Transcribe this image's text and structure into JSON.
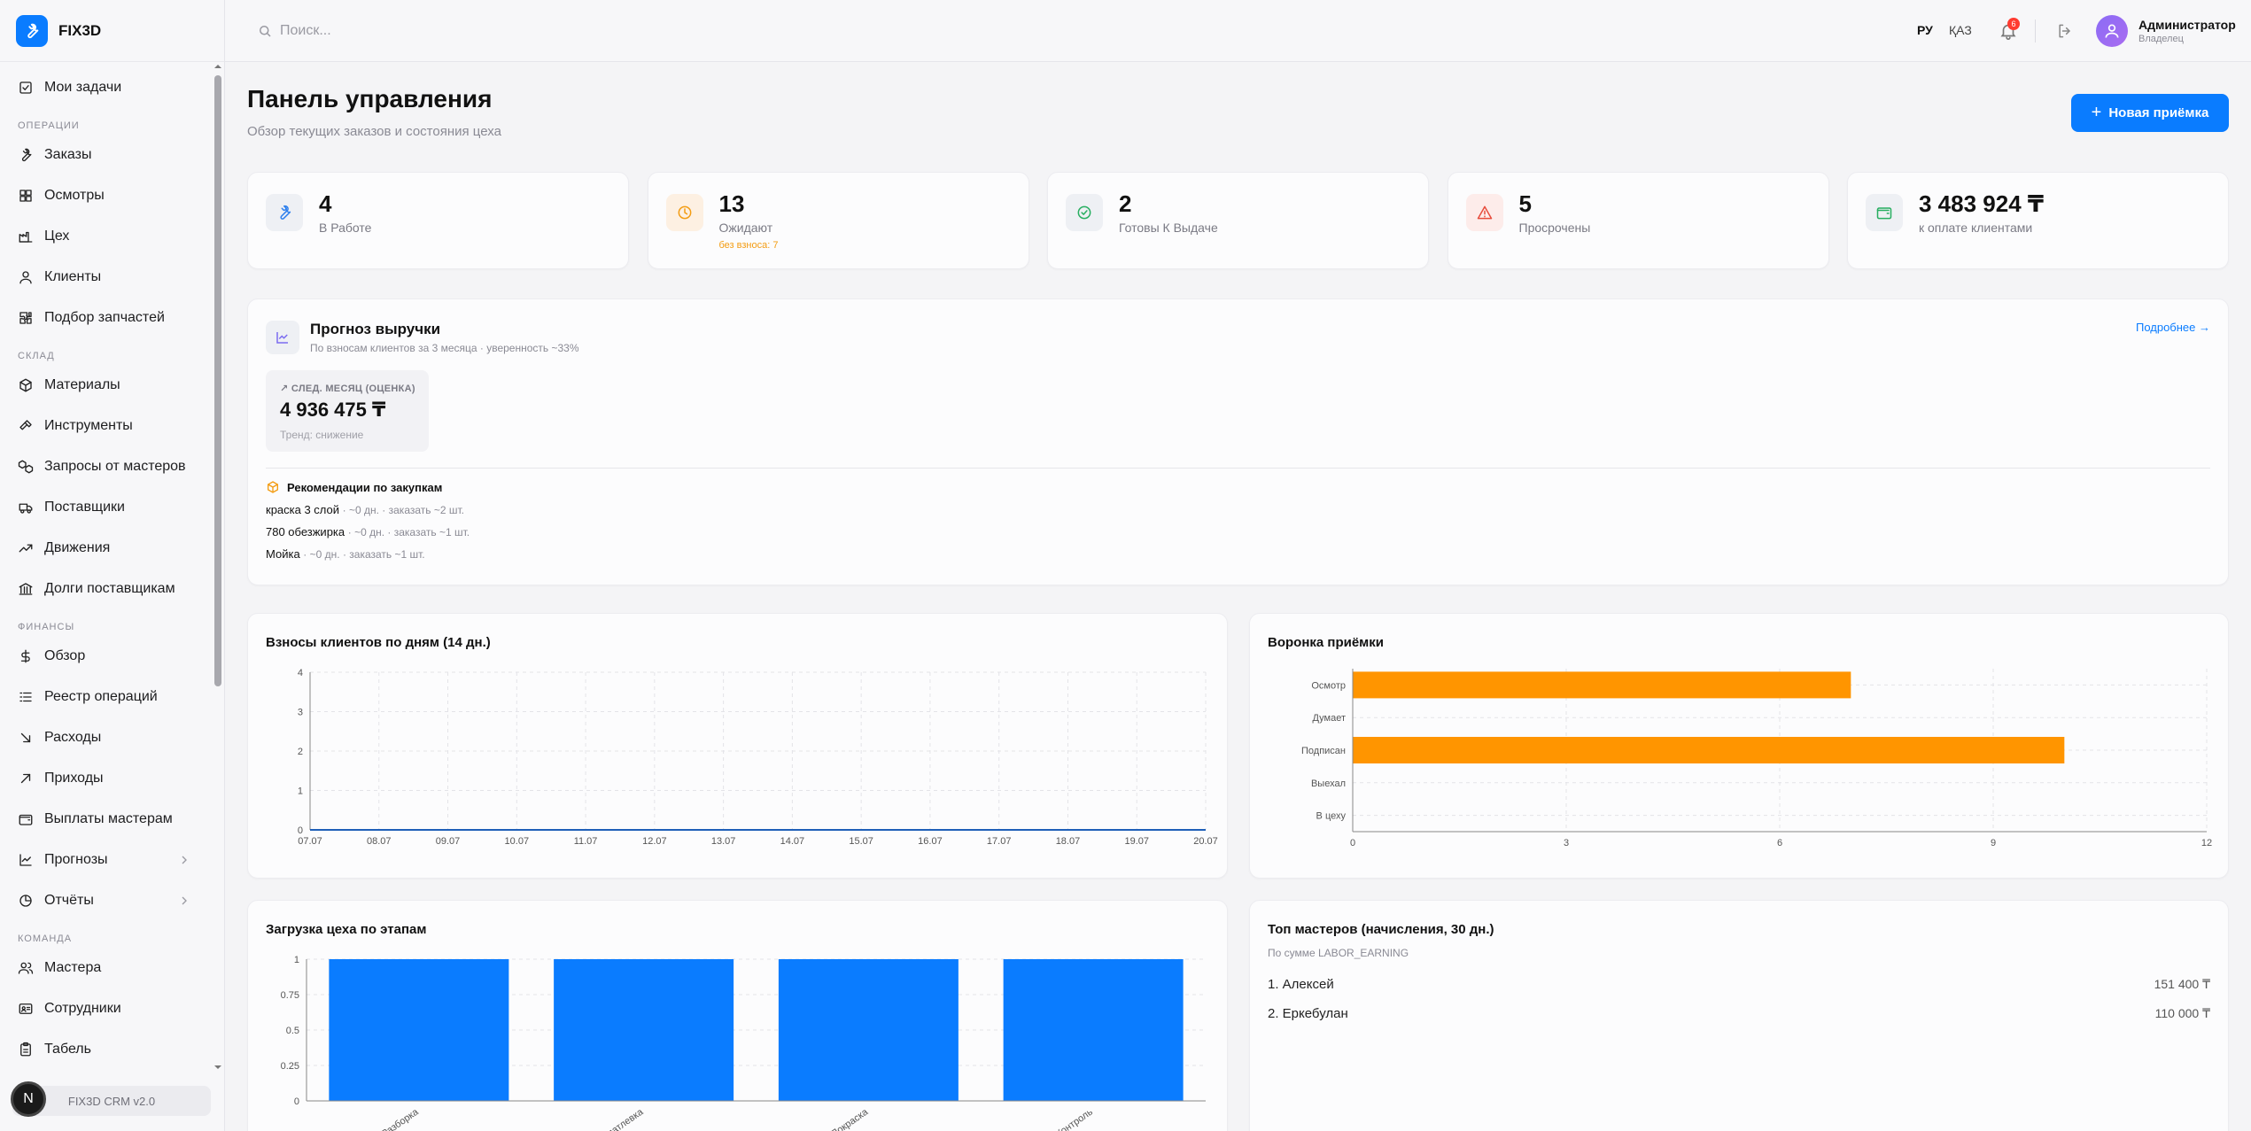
{
  "brand": {
    "name": "FIX3D"
  },
  "search": {
    "placeholder": "Поиск..."
  },
  "header": {
    "lang_ru": "РУ",
    "lang_kz": "ҚАЗ",
    "notifications_count": "6",
    "user_name": "Администратор",
    "user_role": "Владелец"
  },
  "sidebar": {
    "top_item": {
      "label": "Мои задачи",
      "icon": "checkbox-icon"
    },
    "sections": [
      {
        "title": "ОПЕРАЦИИ",
        "items": [
          {
            "label": "Заказы",
            "icon": "wrench-icon"
          },
          {
            "label": "Осмотры",
            "icon": "grid-icon"
          },
          {
            "label": "Цех",
            "icon": "factory-icon"
          },
          {
            "label": "Клиенты",
            "icon": "user-icon"
          },
          {
            "label": "Подбор запчастей",
            "icon": "puzzle-icon"
          }
        ]
      },
      {
        "title": "СКЛАД",
        "items": [
          {
            "label": "Материалы",
            "icon": "box-icon"
          },
          {
            "label": "Инструменты",
            "icon": "hammer-icon"
          },
          {
            "label": "Запросы от мастеров",
            "icon": "boxes-icon"
          },
          {
            "label": "Поставщики",
            "icon": "truck-icon"
          },
          {
            "label": "Движения",
            "icon": "trend-icon"
          },
          {
            "label": "Долги поставщикам",
            "icon": "bank-icon"
          }
        ]
      },
      {
        "title": "ФИНАНСЫ",
        "items": [
          {
            "label": "Обзор",
            "icon": "dollar-icon"
          },
          {
            "label": "Реестр операций",
            "icon": "list-icon"
          },
          {
            "label": "Расходы",
            "icon": "arrow-down-right-icon"
          },
          {
            "label": "Приходы",
            "icon": "arrow-up-right-icon"
          },
          {
            "label": "Выплаты мастерам",
            "icon": "wallet-icon"
          },
          {
            "label": "Прогнозы",
            "icon": "chart-icon",
            "has_children": true
          },
          {
            "label": "Отчёты",
            "icon": "pie-icon",
            "has_children": true
          }
        ]
      },
      {
        "title": "КОМАНДА",
        "items": [
          {
            "label": "Мастера",
            "icon": "users-icon"
          },
          {
            "label": "Сотрудники",
            "icon": "id-card-icon"
          },
          {
            "label": "Табель",
            "icon": "clipboard-icon"
          }
        ]
      }
    ],
    "footer": "FIX3D CRM v2.0",
    "avatar_letter": "N"
  },
  "page": {
    "title": "Панель управления",
    "subtitle": "Обзор текущих заказов и состояния цеха",
    "new_button": "Новая приёмка"
  },
  "stats": [
    {
      "value": "4",
      "label": "В Работе",
      "icon": "wrench-icon",
      "color": "#2f80ed",
      "bg": "#eef0f4"
    },
    {
      "value": "13",
      "label": "Ожидают",
      "sub": "без взноса: 7",
      "icon": "clock-icon",
      "color": "#f39c12",
      "bg": "#fdf0e2"
    },
    {
      "value": "2",
      "label": "Готовы К Выдаче",
      "icon": "check-circle-icon",
      "color": "#27ae60",
      "bg": "#eef0f4"
    },
    {
      "value": "5",
      "label": "Просрочены",
      "icon": "alert-icon",
      "color": "#e74c3c",
      "bg": "#fdecea"
    },
    {
      "value": "3 483 924 ₸",
      "label": "к оплате клиентами",
      "icon": "wallet-icon",
      "color": "#27ae60",
      "bg": "#eef0f4"
    }
  ],
  "forecast": {
    "title": "Прогноз выручки",
    "subtitle": "По взносам клиентов за 3 месяца · уверенность ~33%",
    "more_link": "Подробнее →",
    "box_label": "СЛЕД. МЕСЯЦ (ОЦЕНКА)",
    "box_value": "4 936 475 ₸",
    "box_trend": "Тренд: снижение",
    "rec_title": "Рекомендации по закупкам",
    "recommendations": [
      {
        "name": "краска 3 слой",
        "detail": "· ~0 дн. · заказать ~2 шт."
      },
      {
        "name": "780 обезжирка",
        "detail": "· ~0 дн. · заказать ~1 шт."
      },
      {
        "name": "Мойка",
        "detail": "· ~0 дн. · заказать ~1 шт."
      }
    ]
  },
  "chart_payments": {
    "title": "Взносы клиентов по дням (14 дн.)"
  },
  "chart_funnel": {
    "title": "Воронка приёмки"
  },
  "chart_load": {
    "title": "Загрузка цеха по этапам"
  },
  "top_masters": {
    "title": "Топ мастеров (начисления, 30 дн.)",
    "subtitle": "По сумме LABOR_EARNING",
    "rows": [
      {
        "name": "1. Алексей",
        "amount": "151 400 ₸"
      },
      {
        "name": "2. Еркебулан",
        "amount": "110 000 ₸"
      }
    ]
  },
  "chart_data": [
    {
      "type": "line",
      "x": [
        "07.07",
        "08.07",
        "09.07",
        "10.07",
        "11.07",
        "12.07",
        "13.07",
        "14.07",
        "15.07",
        "16.07",
        "17.07",
        "18.07",
        "19.07",
        "20.07"
      ],
      "series": [
        {
          "values": [
            0,
            0,
            0,
            0,
            0,
            0,
            0,
            0,
            0,
            0,
            0,
            0,
            0,
            0
          ]
        }
      ],
      "yticks": [
        0,
        1,
        2,
        3,
        4
      ],
      "ylim": [
        0,
        4
      ],
      "grid": true,
      "color": "#1f5fb8"
    },
    {
      "type": "bar",
      "orientation": "horizontal",
      "categories": [
        "Осмотр",
        "Думает",
        "Подписан",
        "Выехал",
        "В цеху"
      ],
      "values": [
        7,
        0,
        10,
        0,
        0
      ],
      "xticks": [
        0,
        3,
        6,
        9,
        12
      ],
      "xlim": [
        0,
        12
      ],
      "grid": true,
      "color": "#ff9500"
    },
    {
      "type": "bar",
      "categories": [
        "Разборка",
        "Шпатлевка",
        "Покраска",
        "Контроль"
      ],
      "values": [
        1,
        1,
        1,
        1
      ],
      "yticks": [
        0,
        0.25,
        0.5,
        0.75,
        1
      ],
      "ylim": [
        0,
        1
      ],
      "grid": true,
      "color": "#0a7cff"
    }
  ]
}
